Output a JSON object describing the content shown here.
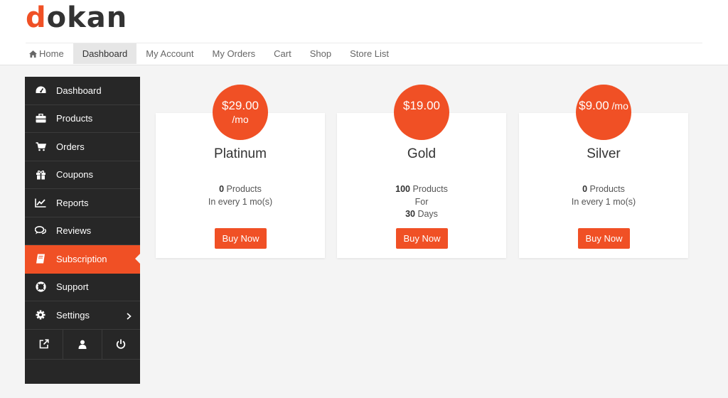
{
  "brand": {
    "first_letter": "d",
    "rest": "okan",
    "accent": "#f05025"
  },
  "topnav": {
    "items": [
      {
        "label": "Home",
        "icon": "home-icon"
      },
      {
        "label": "Dashboard",
        "active": true
      },
      {
        "label": "My Account"
      },
      {
        "label": "My Orders"
      },
      {
        "label": "Cart"
      },
      {
        "label": "Shop"
      },
      {
        "label": "Store List"
      }
    ]
  },
  "sidebar": {
    "items": [
      {
        "label": "Dashboard",
        "icon": "dashboard-gauge-icon"
      },
      {
        "label": "Products",
        "icon": "briefcase-icon"
      },
      {
        "label": "Orders",
        "icon": "cart-icon"
      },
      {
        "label": "Coupons",
        "icon": "gift-icon"
      },
      {
        "label": "Reports",
        "icon": "line-chart-icon"
      },
      {
        "label": "Reviews",
        "icon": "comments-icon"
      },
      {
        "label": "Subscription",
        "icon": "book-icon",
        "active": true
      },
      {
        "label": "Support",
        "icon": "lifebuoy-icon"
      },
      {
        "label": "Settings",
        "icon": "gear-icon",
        "has_submenu": true
      }
    ],
    "bottom_icons": [
      "external-link-icon",
      "user-icon",
      "power-icon"
    ]
  },
  "plans": [
    {
      "price": "$29.00",
      "period": "/mo",
      "name": "Platinum",
      "products_count": "0",
      "products_label": " Products",
      "billing": "In every 1 mo(s)",
      "button": "Buy Now"
    },
    {
      "price": "$19.00",
      "name": "Gold",
      "products_count": "100",
      "products_label": " Products",
      "for_label": "For",
      "days_count": "30",
      "days_label": " Days",
      "button": "Buy Now"
    },
    {
      "price": "$9.00",
      "period": " /mo",
      "name": "Silver",
      "products_count": "0",
      "products_label": " Products",
      "billing": "In every 1 mo(s)",
      "button": "Buy Now"
    }
  ]
}
